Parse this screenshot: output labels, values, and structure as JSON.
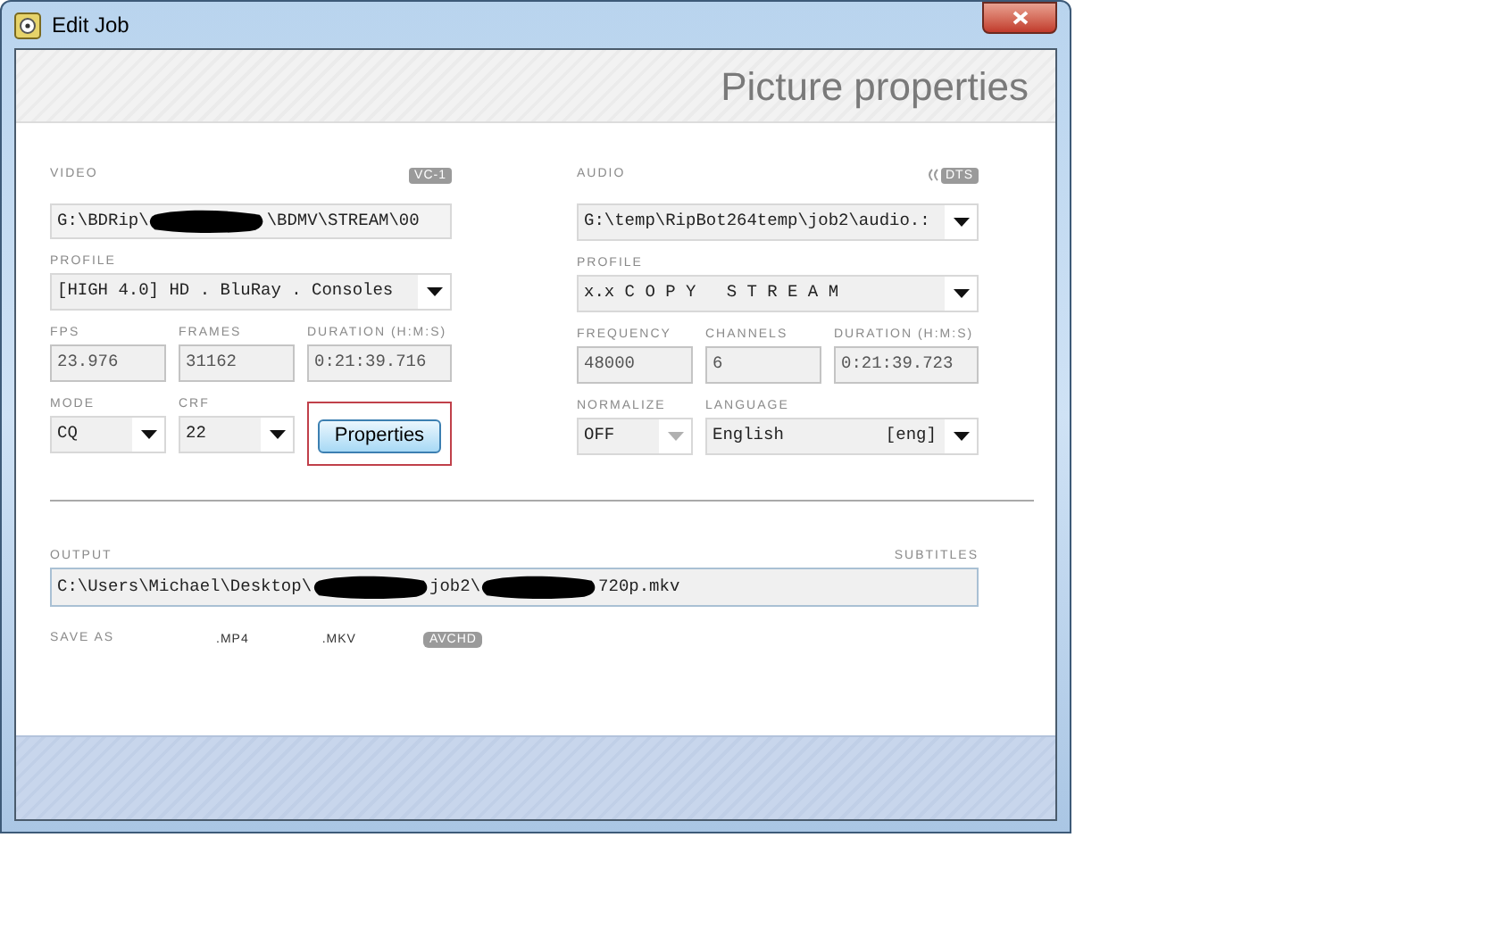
{
  "window": {
    "title": "Edit Job"
  },
  "header": {
    "title": "Picture properties"
  },
  "video": {
    "label": "VIDEO",
    "tag": "VC-1",
    "rows": [
      [
        {
          "kind": "path",
          "parts": [
            "G:\\BDRip\\",
            "\\BDMV\\STREAM\\00"
          ]
        }
      ],
      [
        {
          "kind": "dropdown",
          "label": "PROFILE",
          "value": "[HIGH 4.0] HD . BluRay . Consoles",
          "disabled": false
        }
      ],
      [
        {
          "kind": "readonly",
          "label": "FPS",
          "value": "23.976"
        },
        {
          "kind": "readonly",
          "label": "FRAMES",
          "value": "31162"
        },
        {
          "kind": "readonly",
          "label": "DURATION (H:M:S)",
          "value": "0:21:39.716"
        }
      ],
      [
        {
          "kind": "dropdown",
          "label": "MODE",
          "value": "CQ",
          "disabled": false
        },
        {
          "kind": "dropdown",
          "label": "CRF",
          "value": "22",
          "disabled": false
        },
        {
          "kind": "button",
          "value": "Properties",
          "highlighted": true
        }
      ]
    ]
  },
  "audio": {
    "label": "AUDIO",
    "tag": "DTS",
    "rows": [
      [
        {
          "kind": "dropdown",
          "value": "G:\\temp\\RipBot264temp\\job2\\audio.:",
          "disabled": false
        }
      ],
      [
        {
          "kind": "dropdown",
          "label": "PROFILE",
          "value": "x.x C O P Y   S T R E A M",
          "disabled": false
        }
      ],
      [
        {
          "kind": "readonly",
          "label": "FREQUENCY",
          "value": "48000"
        },
        {
          "kind": "readonly",
          "label": "CHANNELS",
          "value": "6"
        },
        {
          "kind": "readonly",
          "label": "DURATION (H:M:S)",
          "value": "0:21:39.723"
        }
      ],
      [
        {
          "kind": "dropdown",
          "label": "NORMALIZE",
          "value": "OFF",
          "disabled": true
        },
        {
          "kind": "dropdown",
          "label": "LANGUAGE",
          "value": "English          [eng]",
          "disabled": false
        }
      ]
    ]
  },
  "output": {
    "label": "OUTPUT",
    "subtitles_label": "SUBTITLES",
    "parts": [
      "C:\\Users\\Michael\\Desktop\\",
      "job2\\",
      "720p.mkv"
    ]
  },
  "save_as": {
    "label": "SAVE AS",
    "options": [
      {
        "label": ".MP4",
        "selected": false
      },
      {
        "label": ".MKV",
        "selected": false
      },
      {
        "label": "AVCHD",
        "selected": true
      }
    ]
  }
}
